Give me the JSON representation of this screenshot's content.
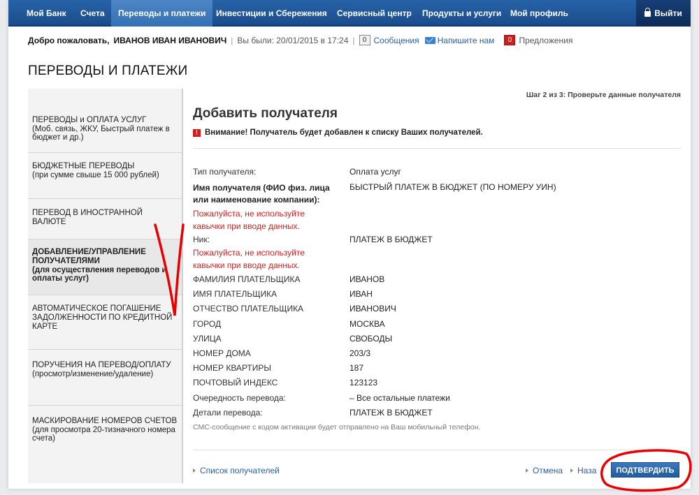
{
  "nav": {
    "items": [
      "Мой Банк",
      "Счета",
      "Переводы и платежи",
      "Инвестиции и Сбережения",
      "Сервисный центр",
      "Продукты и услуги",
      "Мой профиль"
    ],
    "logout": "Выйти"
  },
  "welcome": {
    "greeting": "Добро пожаловать,",
    "user": "ИВАНОВ ИВАН ИВАНОВИЧ",
    "last_visit": "Вы были: 20/01/2015 в 17:24",
    "messages_count": "0",
    "messages": "Сообщения",
    "write_us": "Напишите нам",
    "offers_count": "0",
    "offers": "Предложения"
  },
  "page_title": "ПЕРЕВОДЫ И ПЛАТЕЖИ",
  "sidebar": {
    "items": [
      {
        "title": "ПЕРЕВОДЫ и ОПЛАТА УСЛУГ",
        "sub": "(Моб. связь, ЖКУ, Быстрый платеж в бюджет и др.)"
      },
      {
        "title": "БЮДЖЕТНЫЕ ПЕРЕВОДЫ",
        "sub": "(при сумме свыше 15 000 рублей)"
      },
      {
        "title": "ПЕРЕВОД В ИНОСТРАННОЙ ВАЛЮТЕ",
        "sub": ""
      },
      {
        "title": "ДОБАВЛЕНИЕ/УПРАВЛЕНИЕ ПОЛУЧАТЕЛЯМИ",
        "sub": "(для осуществления переводов и оплаты услуг)"
      },
      {
        "title": "АВТОМАТИЧЕСКОЕ ПОГАШЕНИЕ ЗАДОЛЖЕННОСТИ ПО КРЕДИТНОЙ КАРТЕ",
        "sub": ""
      },
      {
        "title": "ПОРУЧЕНИЯ НА ПЕРЕВОД/ОПЛАТУ",
        "sub": "(просмотр/изменение/удаление)"
      },
      {
        "title": "МАСКИРОВАНИЕ НОМЕРОВ СЧЕТОВ",
        "sub": "(для просмотра 20-тизначного номера счета)"
      }
    ]
  },
  "main": {
    "step": "Шаг 2 из 3: Проверьте данные получателя",
    "heading": "Добавить получателя",
    "warning": "Внимание! Получатель будет добавлен к списку Ваших получателей.",
    "hint": "Пожалуйста, не используйте кавычки при вводе данных.",
    "fields": [
      {
        "label": "Тип получателя:",
        "value": "Оплата услуг"
      },
      {
        "label": "Имя получателя (ФИО физ. лица или наименование компании):",
        "value": "БЫСТРЫЙ ПЛАТЕЖ В БЮДЖЕТ (ПО НОМЕРУ УИН)"
      },
      {
        "label": "Ник:",
        "value": "ПЛАТЕЖ В БЮДЖЕТ"
      },
      {
        "label": "ФАМИЛИЯ ПЛАТЕЛЬЩИКА",
        "value": "ИВАНОВ"
      },
      {
        "label": "ИМЯ ПЛАТЕЛЬЩИКА",
        "value": "ИВАН"
      },
      {
        "label": "ОТЧЕСТВО ПЛАТЕЛЬЩИКА",
        "value": "ИВАНОВИЧ"
      },
      {
        "label": "ГОРОД",
        "value": "МОСКВА"
      },
      {
        "label": "УЛИЦА",
        "value": "СВОБОДЫ"
      },
      {
        "label": "НОМЕР ДОМА",
        "value": "203/3"
      },
      {
        "label": "НОМЕР КВАРТИРЫ",
        "value": "187"
      },
      {
        "label": "ПОЧТОВЫЙ ИНДЕКС",
        "value": "123123"
      },
      {
        "label": "Очередность перевода:",
        "value": "– Все остальные платежи"
      },
      {
        "label": "Детали перевода:",
        "value": "ПЛАТЕЖ В БЮДЖЕТ"
      }
    ],
    "sms_note": "СМС-сообщение с кодом активации будет отправлено на Ваш мобильный телефон.",
    "recipients_link": "Список получателей",
    "cancel": "Отмена",
    "back": "Наза",
    "confirm": "ПОДТВЕРДИТЬ"
  },
  "colors": {
    "brand": "#1a4c8c",
    "warning": "#d02222",
    "link": "#2a5fa0",
    "annotation": "#e80000"
  }
}
